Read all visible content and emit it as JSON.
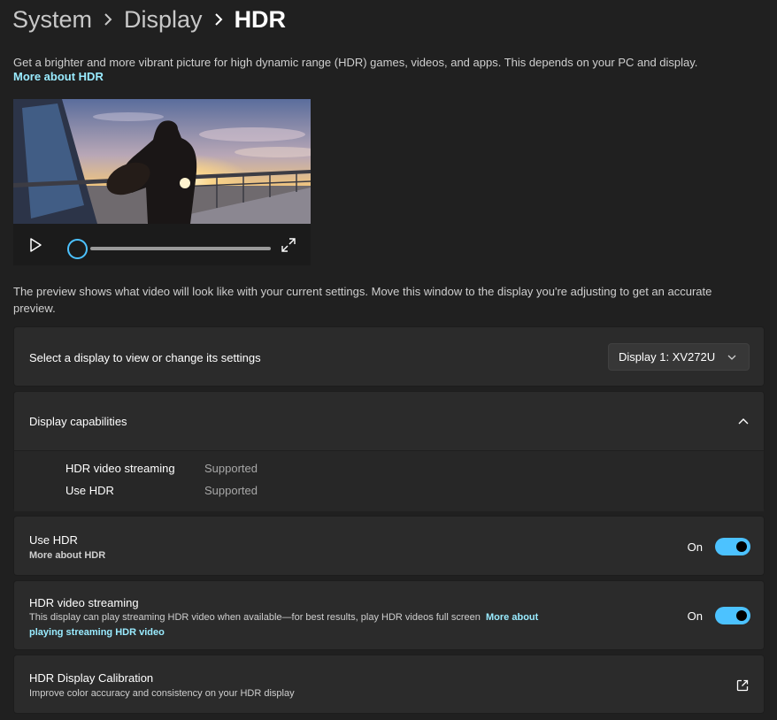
{
  "breadcrumb": {
    "items": [
      "System",
      "Display",
      "HDR"
    ]
  },
  "description": {
    "text": "Get a brighter and more vibrant picture for high dynamic range (HDR) games, videos, and apps. This depends on your PC and display.",
    "link": "More about HDR"
  },
  "video_preview": {
    "progress": 0.0
  },
  "preview_note": "The preview shows what video will look like with your current settings. Move this window to the display you're adjusting to get an accurate preview.",
  "display_select": {
    "label": "Select a display to view or change its settings",
    "value": "Display 1: XV272U"
  },
  "capabilities": {
    "title": "Display capabilities",
    "rows": [
      {
        "name": "HDR video streaming",
        "value": "Supported"
      },
      {
        "name": "Use HDR",
        "value": "Supported"
      }
    ]
  },
  "use_hdr": {
    "title": "Use HDR",
    "link": "More about HDR",
    "state": "On"
  },
  "hdr_streaming": {
    "title": "HDR video streaming",
    "description": "This display can play streaming HDR video when available—for best results, play HDR videos full screen",
    "link_part1": "More about",
    "link_part2": "playing streaming HDR video",
    "state": "On"
  },
  "calibration": {
    "title": "HDR Display Calibration",
    "description": "Improve color accuracy and consistency on your HDR display"
  },
  "colors": {
    "accent": "#4cc2ff",
    "link": "#99ebff",
    "background": "#202020",
    "card": "#2b2b2b"
  },
  "icons": [
    "chevron-right-icon",
    "play-icon",
    "fullscreen-icon",
    "chevron-down-icon",
    "chevron-up-icon",
    "external-link-icon"
  ]
}
